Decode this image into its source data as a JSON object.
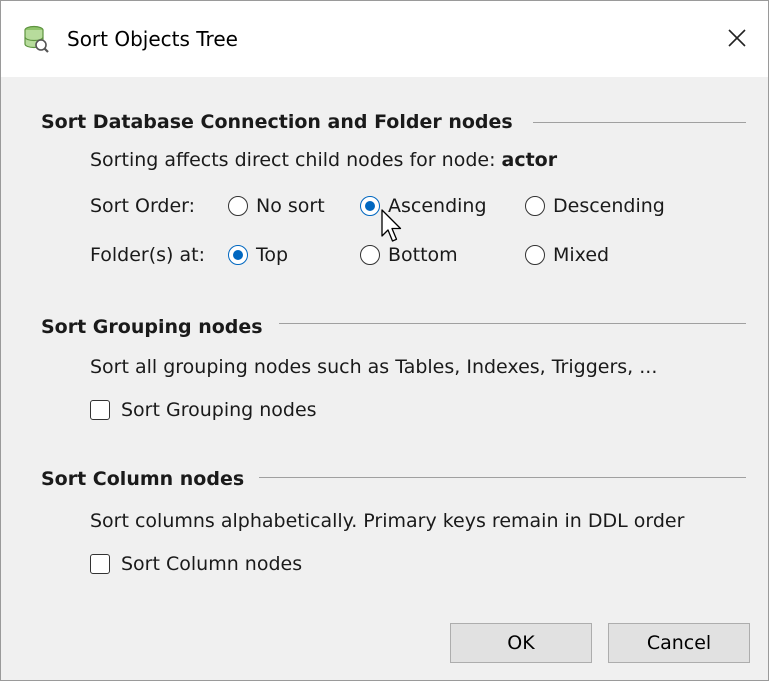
{
  "window": {
    "title": "Sort Objects Tree"
  },
  "db_folder_group": {
    "title": "Sort Database Connection and Folder nodes",
    "description_prefix": "Sorting affects direct child nodes for node: ",
    "description_node": "actor",
    "sort_order": {
      "label": "Sort Order:",
      "options": [
        "No sort",
        "Ascending",
        "Descending"
      ],
      "selected": "Ascending"
    },
    "folders_at": {
      "label": "Folder(s) at:",
      "options": [
        "Top",
        "Bottom",
        "Mixed"
      ],
      "selected": "Top"
    }
  },
  "grouping_group": {
    "title": "Sort Grouping nodes",
    "description": "Sort all grouping nodes such as Tables, Indexes, Triggers, ...",
    "checkbox_label": "Sort Grouping nodes",
    "checked": false
  },
  "column_group": {
    "title": "Sort Column nodes",
    "description": "Sort columns alphabetically. Primary keys remain in DDL order",
    "checkbox_label": "Sort Column nodes",
    "checked": false
  },
  "buttons": {
    "ok": "OK",
    "cancel": "Cancel"
  },
  "colors": {
    "accent": "#0067c0",
    "icon": "#6aa84f"
  }
}
